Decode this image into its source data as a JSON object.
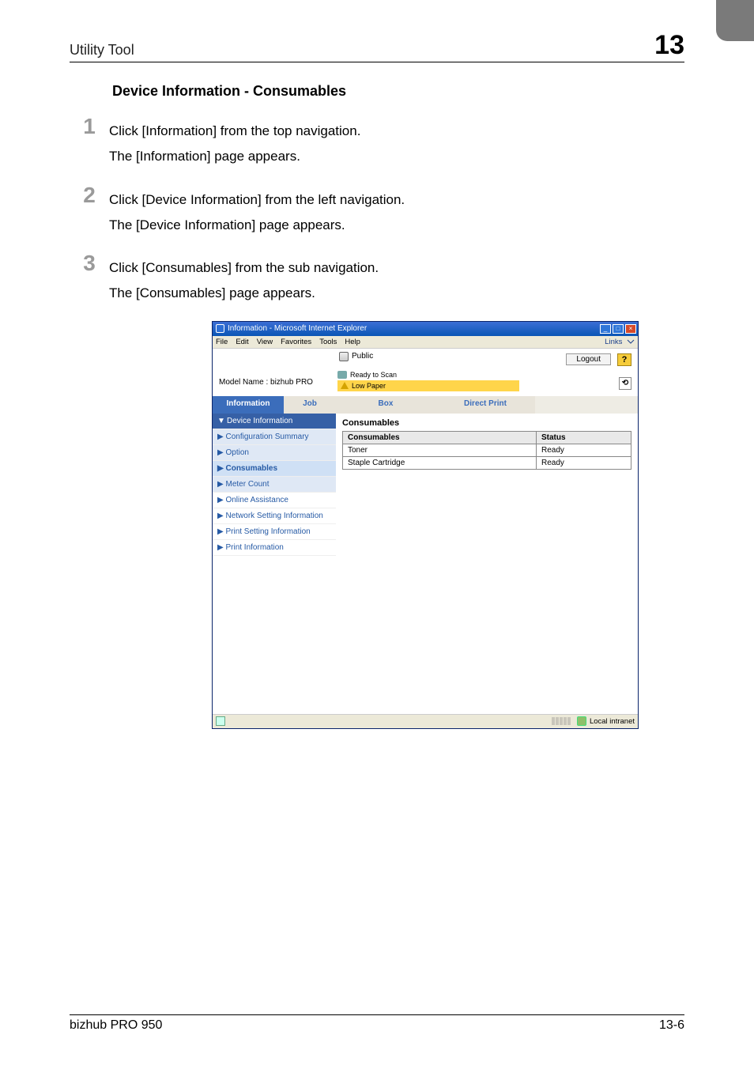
{
  "header": {
    "left": "Utility Tool",
    "right_num": "13"
  },
  "section_heading": "Device Information - Consumables",
  "steps": [
    {
      "num": "1",
      "line1": "Click [Information] from the top navigation.",
      "line2": "The [Information] page appears."
    },
    {
      "num": "2",
      "line1": "Click [Device Information] from the left navigation.",
      "line2": "The [Device Information] page appears."
    },
    {
      "num": "3",
      "line1": "Click [Consumables] from the sub navigation.",
      "line2": "The [Consumables] page appears."
    }
  ],
  "window": {
    "title": "Information - Microsoft Internet Explorer",
    "menus": [
      "File",
      "Edit",
      "View",
      "Favorites",
      "Tools",
      "Help"
    ],
    "links_label": "Links",
    "public_label": "Public",
    "logout_label": "Logout",
    "help_label": "?",
    "model_name": "Model Name : bizhub PRO",
    "status_ready": "Ready to Scan",
    "status_low": "Low Paper",
    "refresh_label": "⟲",
    "tabs": {
      "information": "Information",
      "job": "Job",
      "box": "Box",
      "direct": "Direct Print"
    },
    "nav": {
      "device_info": "Device Information",
      "config_summary": "Configuration Summary",
      "option": "Option",
      "consumables": "Consumables",
      "meter": "Meter Count",
      "online": "Online Assistance",
      "network": "Network Setting Information",
      "print_setting": "Print Setting Information",
      "print_info": "Print Information"
    },
    "content": {
      "heading": "Consumables",
      "col_consumables": "Consumables",
      "col_status": "Status",
      "rows": [
        {
          "name": "Toner",
          "status": "Ready"
        },
        {
          "name": "Staple Cartridge",
          "status": "Ready"
        }
      ]
    },
    "statusbar": {
      "done": "",
      "zone": "Local intranet"
    }
  },
  "footer": {
    "left": "bizhub PRO 950",
    "right": "13-6"
  }
}
